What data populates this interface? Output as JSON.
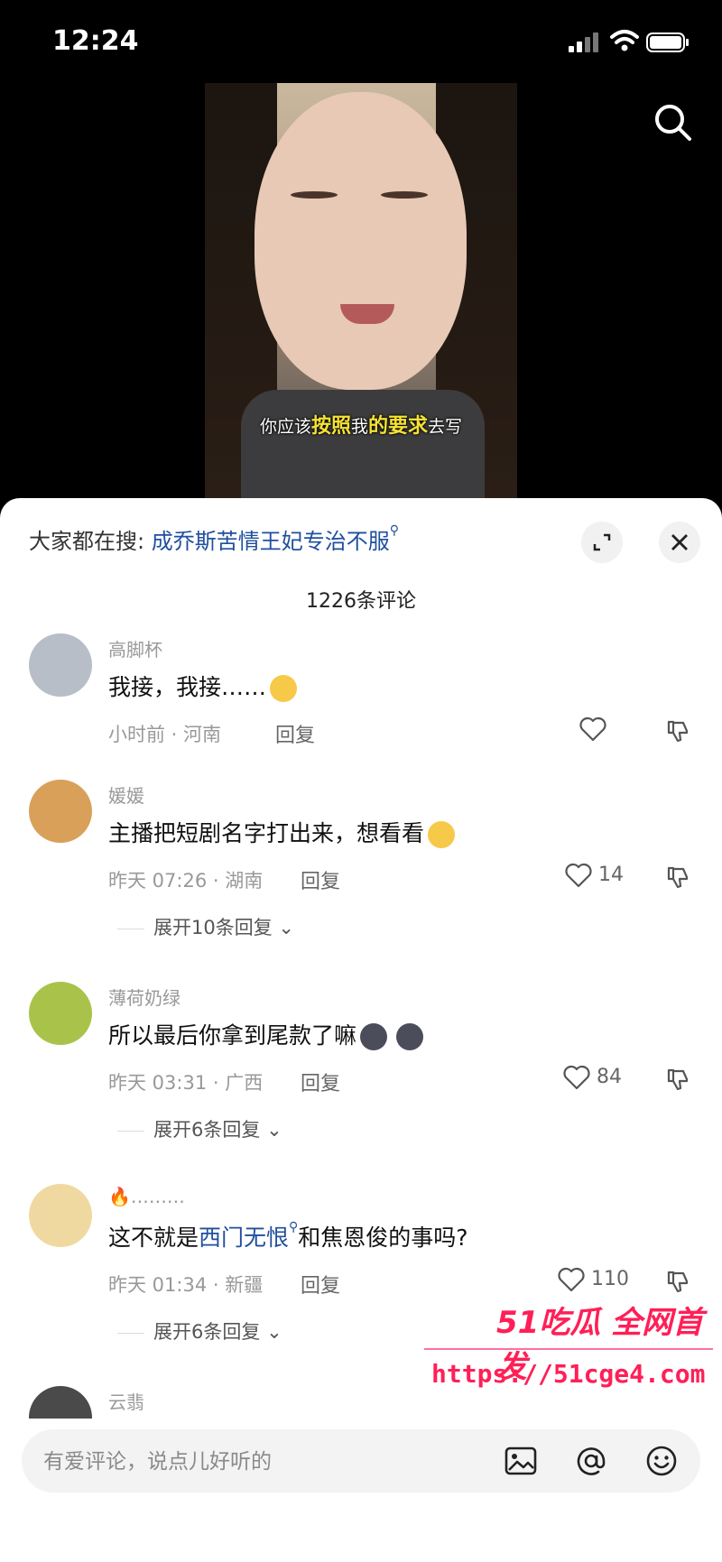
{
  "status_bar": {
    "time": "12:24"
  },
  "video": {
    "subtitle_parts": [
      "你应该",
      "按照",
      "我",
      "的要求",
      "去写"
    ]
  },
  "sheet": {
    "hot_search_prefix": "大家都在搜:",
    "hot_search_term": "成乔斯苦情王妃专治不服",
    "comment_count": "1226条评论"
  },
  "comments": [
    {
      "user": "高脚杯",
      "text": "我接，我接……",
      "time_loc": "小时前 · 河南",
      "reply_label": "回复",
      "likes": "",
      "avatar_color": "#b7bec8"
    },
    {
      "user": "媛媛",
      "text": "主播把短剧名字打出来，想看看",
      "time_loc": "昨天 07:26 · 湖南",
      "reply_label": "回复",
      "likes": "14",
      "expand": "展开10条回复",
      "avatar_color": "#d9a05a"
    },
    {
      "user": "薄荷奶绿",
      "text": "所以最后你拿到尾款了嘛",
      "time_loc": "昨天 03:31 · 广西",
      "reply_label": "回复",
      "likes": "84",
      "expand": "展开6条回复",
      "avatar_color": "#a9c24a"
    },
    {
      "user": "🔥………",
      "text_before": "这不就是",
      "text_link": "西门无恨",
      "text_after": "和焦恩俊的事吗?",
      "time_loc": "昨天 01:34 · 新疆",
      "reply_label": "回复",
      "likes": "110",
      "expand": "展开6条回复",
      "avatar_color": "#f0d9a0"
    },
    {
      "user": "云翡",
      "avatar_color": "#4a4a4a"
    }
  ],
  "input": {
    "placeholder": "有爱评论，说点儿好听的"
  },
  "watermark": {
    "brand": "51吃瓜 全网首发",
    "url": "https://51cge4.com"
  },
  "colors": {
    "link": "#1f4f9e",
    "watermark": "#ff1f57"
  }
}
